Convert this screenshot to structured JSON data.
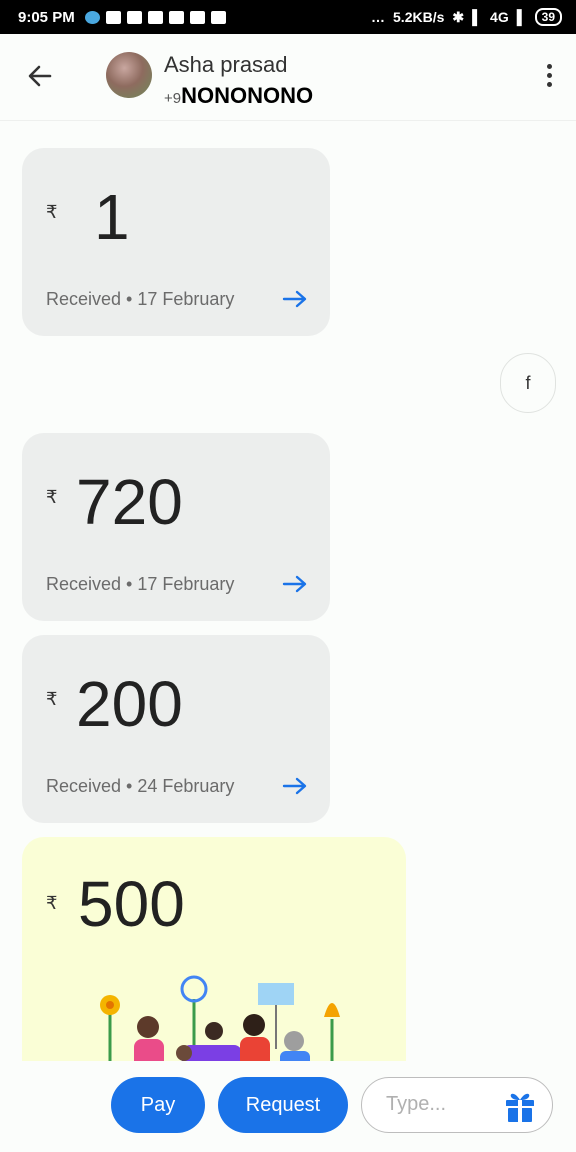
{
  "status_bar": {
    "time": "9:05 PM",
    "dots": "…",
    "speed": "5.2KB/s",
    "network": "4G",
    "battery": "39"
  },
  "header": {
    "contact_name": "Asha prasad",
    "phone_prefix": "+9",
    "phone_rest": "NONONONO"
  },
  "payments": [
    {
      "currency": "₹",
      "amount": "1",
      "status": "Received • 17 February"
    },
    {
      "currency": "₹",
      "amount": "720",
      "status": "Received • 17 February"
    },
    {
      "currency": "₹",
      "amount": "200",
      "status": "Received • 24 February"
    },
    {
      "currency": "₹",
      "amount": "500"
    }
  ],
  "message_bubble": {
    "text": "f"
  },
  "bottom_bar": {
    "pay_label": "Pay",
    "request_label": "Request",
    "type_placeholder": "Type..."
  },
  "colors": {
    "accent": "#1a73e8",
    "card_bg": "#eceeed",
    "gift_card_bg": "#fafed6"
  },
  "icons": [
    "back-arrow-icon",
    "more-vert-icon",
    "arrow-right-icon",
    "gift-icon"
  ]
}
